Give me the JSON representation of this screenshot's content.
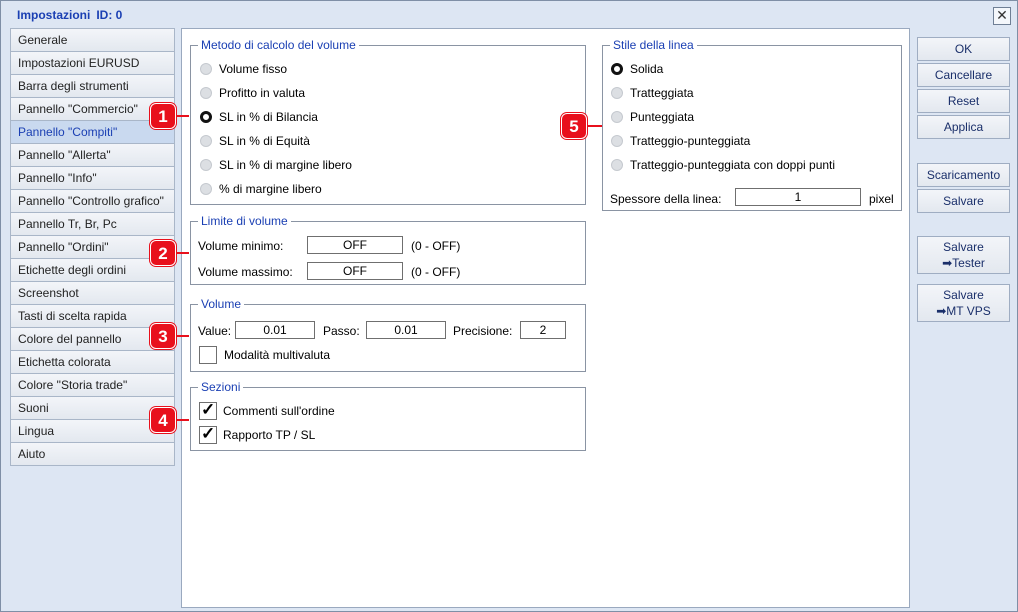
{
  "window": {
    "title": "Impostazioni",
    "id": "ID: 0",
    "close": "✕"
  },
  "sidebar": {
    "items": [
      {
        "label": "Generale"
      },
      {
        "label": "Impostazioni EURUSD"
      },
      {
        "label": "Barra degli strumenti"
      },
      {
        "label": "Pannello \"Commercio\""
      },
      {
        "label": "Pannello \"Compiti\"",
        "active": true
      },
      {
        "label": "Pannello \"Allerta\""
      },
      {
        "label": "Pannello \"Info\""
      },
      {
        "label": "Pannello \"Controllo grafico\""
      },
      {
        "label": "Pannello Tr, Br, Pc"
      },
      {
        "label": "Pannello \"Ordini\""
      },
      {
        "label": "Etichette degli ordini"
      },
      {
        "label": "Screenshot"
      },
      {
        "label": "Tasti di scelta rapida"
      },
      {
        "label": "Colore del pannello"
      },
      {
        "label": "Etichetta colorata"
      },
      {
        "label": "Colore \"Storia trade\""
      },
      {
        "label": "Suoni"
      },
      {
        "label": "Lingua"
      },
      {
        "label": "Aiuto"
      }
    ]
  },
  "volume_method": {
    "title": "Metodo di calcolo del volume",
    "options": [
      "Volume fisso",
      "Profitto in valuta",
      "SL in % di Bilancia",
      "SL in % di Equità",
      "SL in % di margine libero",
      "% di margine libero"
    ],
    "selected": "SL in % di Bilancia"
  },
  "volume_limit": {
    "title": "Limite di volume",
    "min_label": "Volume minimo:",
    "min_value": "OFF",
    "min_hint": "(0 - OFF)",
    "max_label": "Volume massimo:",
    "max_value": "OFF",
    "max_hint": "(0 - OFF)"
  },
  "volume": {
    "title": "Volume",
    "value_label": "Value:",
    "value": "0.01",
    "step_label": "Passo:",
    "step": "0.01",
    "precision_label": "Precisione:",
    "precision": "2",
    "multicurrency_label": "Modalità multivaluta",
    "multicurrency_checked": false
  },
  "sections": {
    "title": "Sezioni",
    "order_comments": "Commenti sull'ordine",
    "order_comments_checked": true,
    "tp_sl_ratio": "Rapporto TP / SL",
    "tp_sl_ratio_checked": true,
    "checkmark": "✓"
  },
  "line_style": {
    "title": "Stile della linea",
    "options": [
      "Solida",
      "Tratteggiata",
      "Punteggiata",
      "Tratteggio-punteggiata",
      "Tratteggio-punteggiata con doppi punti"
    ],
    "selected": "Solida",
    "width_label": "Spessore della linea:",
    "width_value": "1",
    "width_unit": "pixel"
  },
  "buttons": {
    "ok": "OK",
    "cancel": "Cancellare",
    "reset": "Reset",
    "apply": "Applica",
    "download": "Scaricamento",
    "save": "Salvare",
    "save_tester_1": "Salvare",
    "save_tester_2": "➡Tester",
    "save_vps_1": "Salvare",
    "save_vps_2": "➡MT VPS"
  },
  "badges": [
    "1",
    "2",
    "3",
    "4",
    "5"
  ],
  "colors": {
    "accent": "#1a3fb3",
    "badge": "#e8101c",
    "window_bg": "#dde6f3"
  }
}
